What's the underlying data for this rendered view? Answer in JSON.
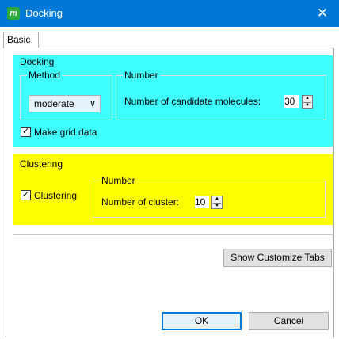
{
  "window": {
    "title": "Docking",
    "app_icon_letter": "m",
    "close_glyph": "✕"
  },
  "tabs": [
    {
      "label": "Basic",
      "selected": true
    }
  ],
  "docking_group": {
    "title": "Docking",
    "background_color": "#40ffff",
    "method": {
      "title": "Method",
      "selected": "moderate",
      "chevron_glyph": "∨"
    },
    "number": {
      "title": "Number",
      "label": "Number of candidate molecules:",
      "value": "30"
    },
    "make_grid_data": {
      "label": "Make grid data",
      "checked": true,
      "check_glyph": "✓"
    }
  },
  "clustering_group": {
    "title": "Clustering",
    "background_color": "#ffff00",
    "clustering_checkbox": {
      "label": "Clustering",
      "checked": true,
      "check_glyph": "✓"
    },
    "number": {
      "title": "Number",
      "label": "Number of cluster:",
      "value": "10"
    }
  },
  "spinner_glyphs": {
    "up": "▲",
    "down": "▼"
  },
  "buttons": {
    "show_customize_tabs": "Show Customize Tabs",
    "ok": "OK",
    "cancel": "Cancel"
  }
}
